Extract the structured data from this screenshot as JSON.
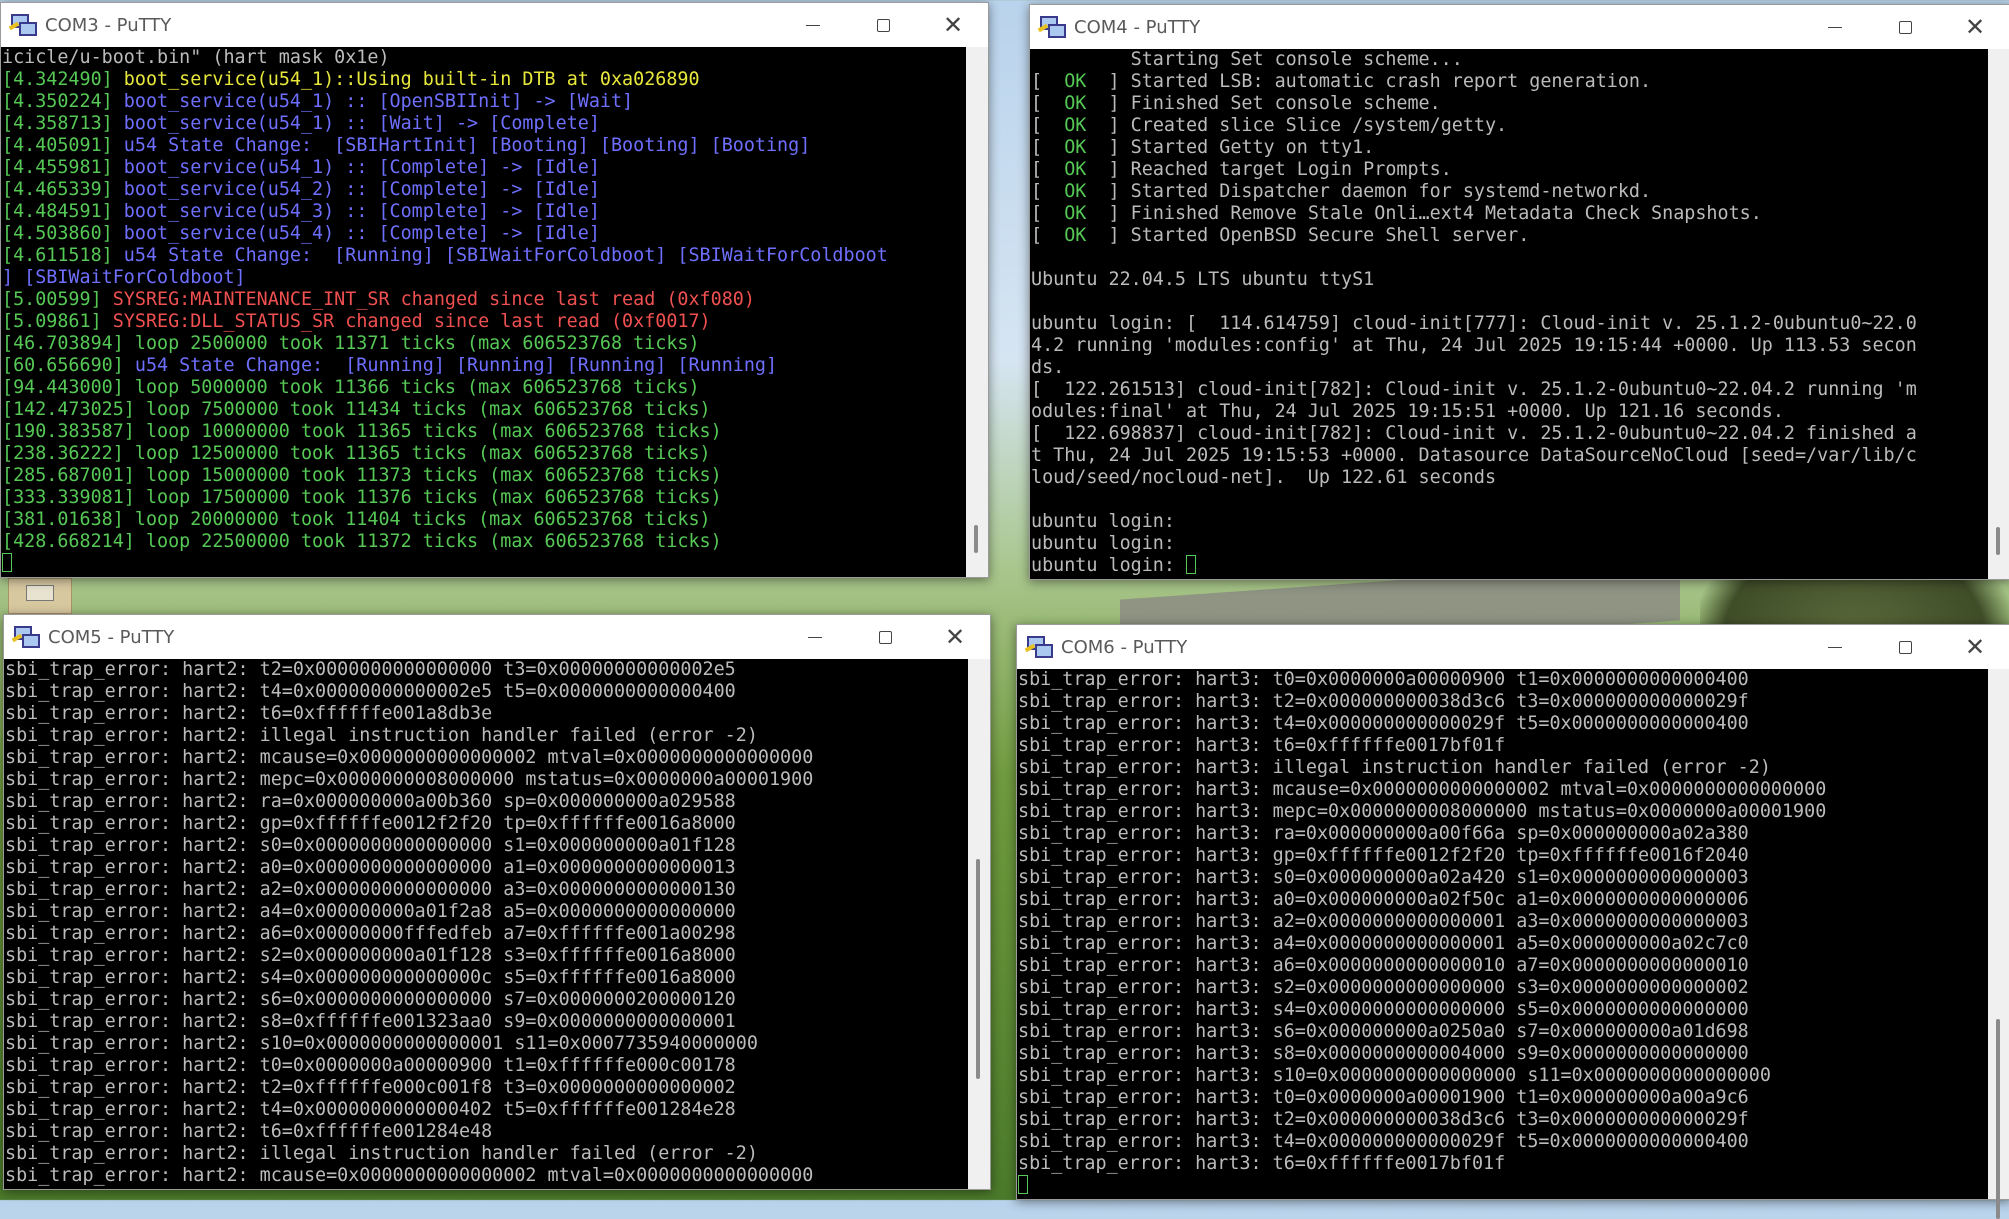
{
  "windows": {
    "com3": {
      "title": "COM3 - PuTTY",
      "lines": [
        {
          "cls": "c-gray",
          "text": "icicle/u-boot.bin\" (hart mask 0x1e)"
        },
        {
          "cls": "c-green",
          "ts": "[4.342490]",
          "cls2": "c-yellow",
          "text": " boot_service(u54_1)::Using built-in DTB at 0xa026890"
        },
        {
          "cls": "c-green",
          "ts": "[4.350224]",
          "cls2": "c-blue",
          "text": " boot_service(u54_1) :: [OpenSBIInit] -> [Wait]"
        },
        {
          "cls": "c-green",
          "ts": "[4.358713]",
          "cls2": "c-blue",
          "text": " boot_service(u54_1) :: [Wait] -> [Complete]"
        },
        {
          "cls": "c-green",
          "ts": "[4.405091]",
          "cls2": "c-blue",
          "text": " u54 State Change:  [SBIHartInit] [Booting] [Booting] [Booting]"
        },
        {
          "cls": "c-green",
          "ts": "[4.455981]",
          "cls2": "c-blue",
          "text": " boot_service(u54_1) :: [Complete] -> [Idle]"
        },
        {
          "cls": "c-green",
          "ts": "[4.465339]",
          "cls2": "c-blue",
          "text": " boot_service(u54_2) :: [Complete] -> [Idle]"
        },
        {
          "cls": "c-green",
          "ts": "[4.484591]",
          "cls2": "c-blue",
          "text": " boot_service(u54_3) :: [Complete] -> [Idle]"
        },
        {
          "cls": "c-green",
          "ts": "[4.503860]",
          "cls2": "c-blue",
          "text": " boot_service(u54_4) :: [Complete] -> [Idle]"
        },
        {
          "cls": "c-green",
          "ts": "[4.611518]",
          "cls2": "c-blue",
          "text": " u54 State Change:  [Running] [SBIWaitForColdboot] [SBIWaitForColdboot"
        },
        {
          "cls": "c-blue",
          "text": "] [SBIWaitForColdboot]"
        },
        {
          "cls": "c-green",
          "ts": "[5.00599]",
          "cls2": "c-red",
          "text": " SYSREG:MAINTENANCE_INT_SR changed since last read (0xf080)"
        },
        {
          "cls": "c-green",
          "ts": "[5.09861]",
          "cls2": "c-red",
          "text": " SYSREG:DLL_STATUS_SR changed since last read (0xf0017)"
        },
        {
          "cls": "c-green",
          "ts": "[46.703894]",
          "cls2": "c-green",
          "text": " loop 2500000 took 11371 ticks (max 606523768 ticks)"
        },
        {
          "cls": "c-green",
          "ts": "[60.656690]",
          "cls2": "c-blue",
          "text": " u54 State Change:  [Running] [Running] [Running] [Running]"
        },
        {
          "cls": "c-green",
          "ts": "[94.443000]",
          "cls2": "c-green",
          "text": " loop 5000000 took 11366 ticks (max 606523768 ticks)"
        },
        {
          "cls": "c-green",
          "ts": "[142.473025]",
          "cls2": "c-green",
          "text": " loop 7500000 took 11434 ticks (max 606523768 ticks)"
        },
        {
          "cls": "c-green",
          "ts": "[190.383587]",
          "cls2": "c-green",
          "text": " loop 10000000 took 11365 ticks (max 606523768 ticks)"
        },
        {
          "cls": "c-green",
          "ts": "[238.36222]",
          "cls2": "c-green",
          "text": " loop 12500000 took 11365 ticks (max 606523768 ticks)"
        },
        {
          "cls": "c-green",
          "ts": "[285.687001]",
          "cls2": "c-green",
          "text": " loop 15000000 took 11373 ticks (max 606523768 ticks)"
        },
        {
          "cls": "c-green",
          "ts": "[333.339081]",
          "cls2": "c-green",
          "text": " loop 17500000 took 11376 ticks (max 606523768 ticks)"
        },
        {
          "cls": "c-green",
          "ts": "[381.01638]",
          "cls2": "c-green",
          "text": " loop 20000000 took 11404 ticks (max 606523768 ticks)"
        },
        {
          "cls": "c-green",
          "ts": "[428.668214]",
          "cls2": "c-green",
          "text": " loop 22500000 took 11372 ticks (max 606523768 ticks)"
        }
      ]
    },
    "com4": {
      "title": "COM4 - PuTTY",
      "lines": [
        {
          "pre": "         ",
          "text": "Starting Set console scheme..."
        },
        {
          "ok": "OK",
          "text": "Started LSB: automatic crash report generation."
        },
        {
          "ok": "OK",
          "text": "Finished Set console scheme."
        },
        {
          "ok": "OK",
          "text": "Created slice Slice /system/getty."
        },
        {
          "ok": "OK",
          "text": "Started Getty on tty1."
        },
        {
          "ok": "OK",
          "text": "Reached target Login Prompts."
        },
        {
          "ok": "OK",
          "text": "Started Dispatcher daemon for systemd-networkd."
        },
        {
          "ok": "OK",
          "text": "Finished Remove Stale Onli…ext4 Metadata Check Snapshots."
        },
        {
          "ok": "OK",
          "text": "Started OpenBSD Secure Shell server."
        },
        {
          "text": ""
        },
        {
          "text": "Ubuntu 22.04.5 LTS ubuntu ttyS1"
        },
        {
          "text": ""
        },
        {
          "text": "ubuntu login: [  114.614759] cloud-init[777]: Cloud-init v. 25.1.2-0ubuntu0~22.0"
        },
        {
          "text": "4.2 running 'modules:config' at Thu, 24 Jul 2025 19:15:44 +0000. Up 113.53 secon"
        },
        {
          "text": "ds."
        },
        {
          "text": "[  122.261513] cloud-init[782]: Cloud-init v. 25.1.2-0ubuntu0~22.04.2 running 'm"
        },
        {
          "text": "odules:final' at Thu, 24 Jul 2025 19:15:51 +0000. Up 121.16 seconds."
        },
        {
          "text": "[  122.698837] cloud-init[782]: Cloud-init v. 25.1.2-0ubuntu0~22.04.2 finished a"
        },
        {
          "text": "t Thu, 24 Jul 2025 19:15:53 +0000. Datasource DataSourceNoCloud [seed=/var/lib/c"
        },
        {
          "text": "loud/seed/nocloud-net].  Up 122.61 seconds"
        },
        {
          "text": ""
        },
        {
          "text": "ubuntu login: "
        },
        {
          "text": "ubuntu login: "
        },
        {
          "text": "ubuntu login: ",
          "cursor": true
        }
      ]
    },
    "com5": {
      "title": "COM5 - PuTTY",
      "lines": [
        "sbi_trap_error: hart2: t2=0x0000000000000000 t3=0x00000000000002e5",
        "sbi_trap_error: hart2: t4=0x00000000000002e5 t5=0x0000000000000400",
        "sbi_trap_error: hart2: t6=0xffffffe001a8db3e",
        "sbi_trap_error: hart2: illegal instruction handler failed (error -2)",
        "sbi_trap_error: hart2: mcause=0x0000000000000002 mtval=0x0000000000000000",
        "sbi_trap_error: hart2: mepc=0x0000000008000000 mstatus=0x0000000a00001900",
        "sbi_trap_error: hart2: ra=0x000000000a00b360 sp=0x000000000a029588",
        "sbi_trap_error: hart2: gp=0xffffffe0012f2f20 tp=0xffffffe0016a8000",
        "sbi_trap_error: hart2: s0=0x0000000000000000 s1=0x000000000a01f128",
        "sbi_trap_error: hart2: a0=0x0000000000000000 a1=0x0000000000000013",
        "sbi_trap_error: hart2: a2=0x0000000000000000 a3=0x0000000000000130",
        "sbi_trap_error: hart2: a4=0x000000000a01f2a8 a5=0x0000000000000000",
        "sbi_trap_error: hart2: a6=0x00000000fffedfeb a7=0xffffffe001a00298",
        "sbi_trap_error: hart2: s2=0x000000000a01f128 s3=0xffffffe0016a8000",
        "sbi_trap_error: hart2: s4=0x000000000000000c s5=0xffffffe0016a8000",
        "sbi_trap_error: hart2: s6=0x0000000000000000 s7=0x0000000200000120",
        "sbi_trap_error: hart2: s8=0xffffffe001323aa0 s9=0x0000000000000001",
        "sbi_trap_error: hart2: s10=0x0000000000000001 s11=0x0007735940000000",
        "sbi_trap_error: hart2: t0=0x0000000a00000900 t1=0xffffffe000c00178",
        "sbi_trap_error: hart2: t2=0xffffffe000c001f8 t3=0x0000000000000002",
        "sbi_trap_error: hart2: t4=0x0000000000000402 t5=0xffffffe001284e28",
        "sbi_trap_error: hart2: t6=0xffffffe001284e48",
        "sbi_trap_error: hart2: illegal instruction handler failed (error -2)",
        "sbi_trap_error: hart2: mcause=0x0000000000000002 mtval=0x0000000000000000"
      ]
    },
    "com6": {
      "title": "COM6 - PuTTY",
      "lines": [
        "sbi_trap_error: hart3: t0=0x0000000a00000900 t1=0x0000000000000400",
        "sbi_trap_error: hart3: t2=0x000000000038d3c6 t3=0x000000000000029f",
        "sbi_trap_error: hart3: t4=0x000000000000029f t5=0x0000000000000400",
        "sbi_trap_error: hart3: t6=0xffffffe0017bf01f",
        "sbi_trap_error: hart3: illegal instruction handler failed (error -2)",
        "sbi_trap_error: hart3: mcause=0x0000000000000002 mtval=0x0000000000000000",
        "sbi_trap_error: hart3: mepc=0x0000000008000000 mstatus=0x0000000a00001900",
        "sbi_trap_error: hart3: ra=0x000000000a00f66a sp=0x000000000a02a380",
        "sbi_trap_error: hart3: gp=0xffffffe0012f2f20 tp=0xffffffe0016f2040",
        "sbi_trap_error: hart3: s0=0x000000000a02a420 s1=0x0000000000000003",
        "sbi_trap_error: hart3: a0=0x000000000a02f50c a1=0x0000000000000006",
        "sbi_trap_error: hart3: a2=0x0000000000000001 a3=0x0000000000000003",
        "sbi_trap_error: hart3: a4=0x0000000000000001 a5=0x000000000a02c7c0",
        "sbi_trap_error: hart3: a6=0x0000000000000010 a7=0x0000000000000010",
        "sbi_trap_error: hart3: s2=0x0000000000000000 s3=0x0000000000000002",
        "sbi_trap_error: hart3: s4=0x0000000000000000 s5=0x0000000000000000",
        "sbi_trap_error: hart3: s6=0x000000000a0250a0 s7=0x000000000a01d698",
        "sbi_trap_error: hart3: s8=0x0000000000004000 s9=0x0000000000000000",
        "sbi_trap_error: hart3: s10=0x0000000000000000 s11=0x0000000000000000",
        "sbi_trap_error: hart3: t0=0x0000000a00001900 t1=0x000000000a00a9c6",
        "sbi_trap_error: hart3: t2=0x000000000038d3c6 t3=0x000000000000029f",
        "sbi_trap_error: hart3: t4=0x000000000000029f t5=0x0000000000000400",
        "sbi_trap_error: hart3: t6=0xffffffe0017bf01f"
      ]
    }
  }
}
